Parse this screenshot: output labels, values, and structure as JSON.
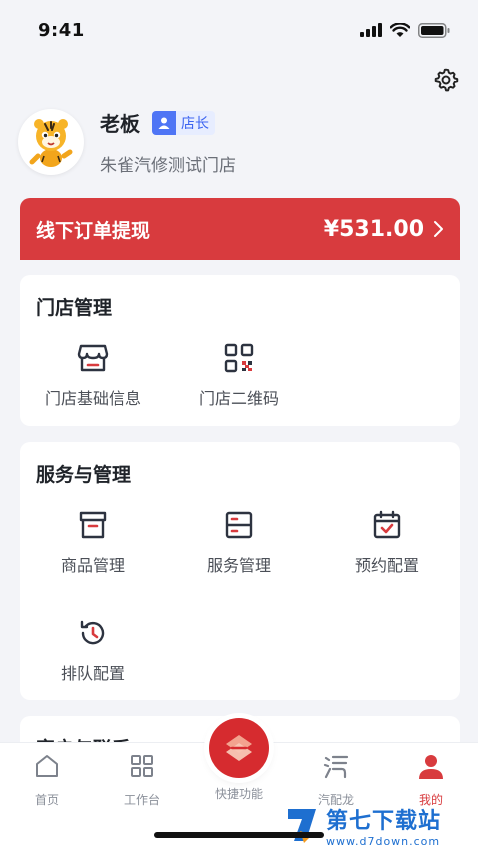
{
  "status_bar": {
    "time": "9:41"
  },
  "profile": {
    "name": "老板",
    "role": "店长",
    "store": "朱雀汽修测试门店"
  },
  "withdraw": {
    "title": "线下订单提现",
    "amount": "¥531.00"
  },
  "store_management": {
    "title": "门店管理",
    "items": [
      {
        "label": "门店基础信息",
        "icon": "store-icon"
      },
      {
        "label": "门店二维码",
        "icon": "qr-code-icon"
      }
    ]
  },
  "service_management": {
    "title": "服务与管理",
    "items": [
      {
        "label": "商品管理",
        "icon": "product-box-icon"
      },
      {
        "label": "服务管理",
        "icon": "service-list-icon"
      },
      {
        "label": "预约配置",
        "icon": "calendar-check-icon"
      },
      {
        "label": "排队配置",
        "icon": "history-icon"
      }
    ]
  },
  "partial_section": {
    "title": "客户与联系"
  },
  "tab_bar": {
    "tabs": [
      {
        "label": "首页",
        "icon": "home-icon"
      },
      {
        "label": "工作台",
        "icon": "grid-icon"
      },
      {
        "label": "快捷功能",
        "icon": "quick-action-icon"
      },
      {
        "label": "汽配龙",
        "icon": "qipeilong-icon"
      },
      {
        "label": "我的",
        "icon": "user-icon"
      }
    ],
    "active": "我的"
  },
  "watermark": {
    "title": "第七下载站",
    "url": "www.d7down.com"
  },
  "colors": {
    "primary_red": "#d83b3e",
    "badge_blue": "#4f75f5",
    "background": "#f3f4f8"
  }
}
